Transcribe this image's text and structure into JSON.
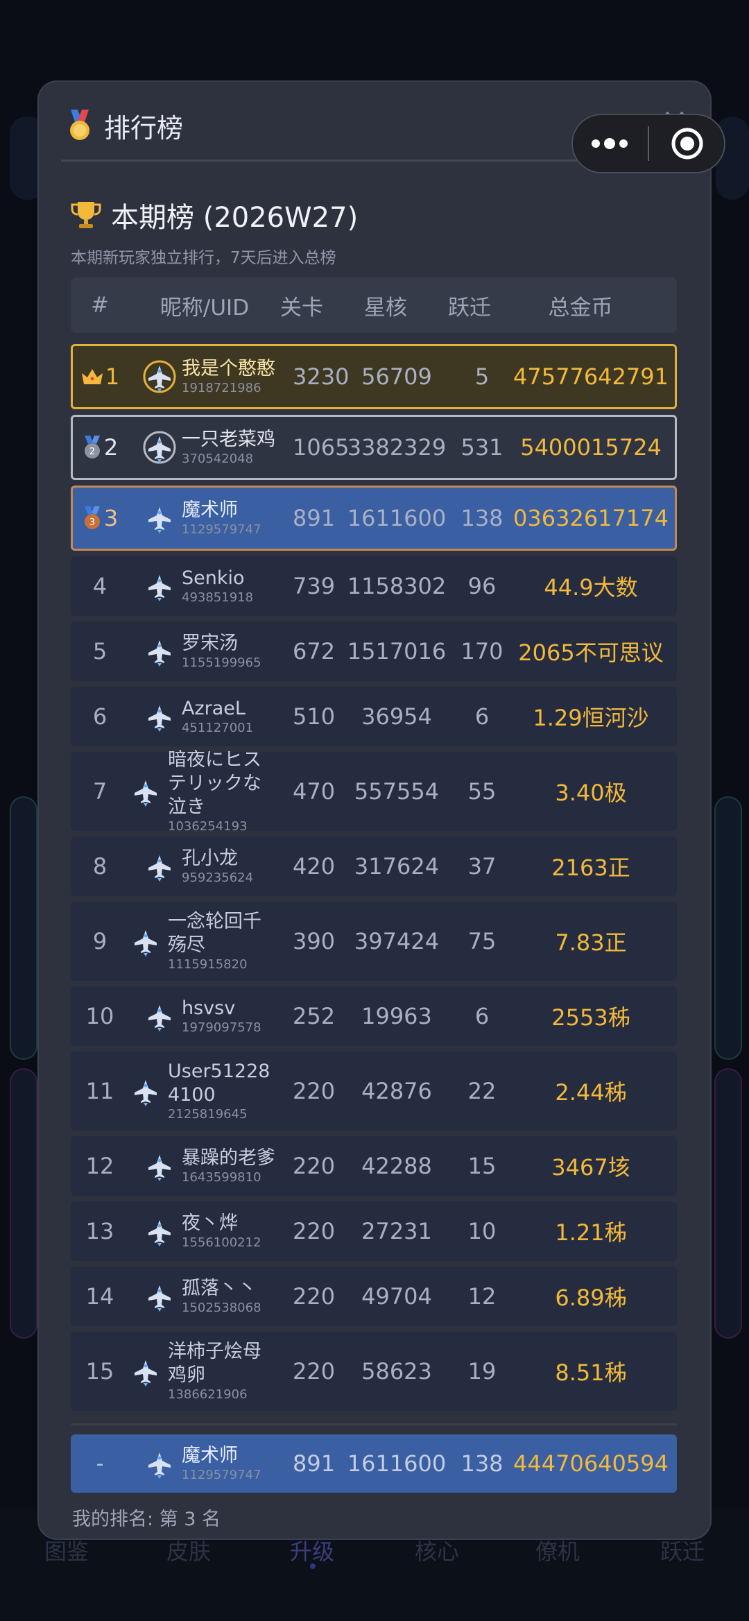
{
  "modal": {
    "title": "排行榜",
    "close_icon": "close-icon",
    "section_title": "本期榜 (2026W27)",
    "section_subtitle": "本期新玩家独立排行，7天后进入总榜",
    "my_rank_text": "我的排名: 第 3 名"
  },
  "table": {
    "headers": {
      "rank": "#",
      "name": "昵称/UID",
      "level": "关卡",
      "star": "星核",
      "warp": "跃迁",
      "coin": "总金币"
    },
    "rows": [
      {
        "rank": "1",
        "name": "我是个憨憨",
        "uid": "1918721986",
        "level": "3230",
        "star": "56709",
        "warp": "5",
        "coin": "47577642791"
      },
      {
        "rank": "2",
        "name": "一只老菜鸡",
        "uid": "370542048",
        "level": "1065",
        "star": "3382329",
        "warp": "531",
        "coin": "5400015724"
      },
      {
        "rank": "3",
        "name": "魔术师",
        "uid": "1129579747",
        "level": "891",
        "star": "1611600",
        "warp": "138",
        "coin": "03632617174"
      },
      {
        "rank": "4",
        "name": "Senkio",
        "uid": "493851918",
        "level": "739",
        "star": "1158302",
        "warp": "96",
        "coin": "44.9大数"
      },
      {
        "rank": "5",
        "name": "罗宋汤",
        "uid": "1155199965",
        "level": "672",
        "star": "1517016",
        "warp": "170",
        "coin": "2065不可思议"
      },
      {
        "rank": "6",
        "name": "AzraeL",
        "uid": "451127001",
        "level": "510",
        "star": "36954",
        "warp": "6",
        "coin": "1.29恒河沙"
      },
      {
        "rank": "7",
        "name": "暗夜にヒステリックな泣き",
        "uid": "1036254193",
        "level": "470",
        "star": "557554",
        "warp": "55",
        "coin": "3.40极"
      },
      {
        "rank": "8",
        "name": "孔小龙",
        "uid": "959235624",
        "level": "420",
        "star": "317624",
        "warp": "37",
        "coin": "2163正"
      },
      {
        "rank": "9",
        "name": "一念轮回千殇尽",
        "uid": "1115915820",
        "level": "390",
        "star": "397424",
        "warp": "75",
        "coin": "7.83正"
      },
      {
        "rank": "10",
        "name": "hsvsv",
        "uid": "1979097578",
        "level": "252",
        "star": "19963",
        "warp": "6",
        "coin": "2553秭"
      },
      {
        "rank": "11",
        "name": "User512284100",
        "uid": "2125819645",
        "level": "220",
        "star": "42876",
        "warp": "22",
        "coin": "2.44秭"
      },
      {
        "rank": "12",
        "name": "暴躁的老爹",
        "uid": "1643599810",
        "level": "220",
        "star": "42288",
        "warp": "15",
        "coin": "3467垓"
      },
      {
        "rank": "13",
        "name": "夜丶烨",
        "uid": "1556100212",
        "level": "220",
        "star": "27231",
        "warp": "10",
        "coin": "1.21秭"
      },
      {
        "rank": "14",
        "name": "孤落丶丶",
        "uid": "1502538068",
        "level": "220",
        "star": "49704",
        "warp": "12",
        "coin": "6.89秭"
      },
      {
        "rank": "15",
        "name": "洋柿子烩母鸡卵",
        "uid": "1386621906",
        "level": "220",
        "star": "58623",
        "warp": "19",
        "coin": "8.51秭"
      }
    ],
    "self": {
      "rank": "-",
      "name": "魔术师",
      "uid": "1129579747",
      "level": "891",
      "star": "1611600",
      "warp": "138",
      "coin": "44470640594"
    }
  },
  "bottom_nav": {
    "items": [
      "图鉴",
      "皮肤",
      "升级",
      "核心",
      "僚机",
      "跃迁"
    ],
    "active": "升级"
  },
  "colors": {
    "modal_bg": "#2e323f",
    "gold": "#f2b93b",
    "highlight": "#3a5fa3"
  }
}
